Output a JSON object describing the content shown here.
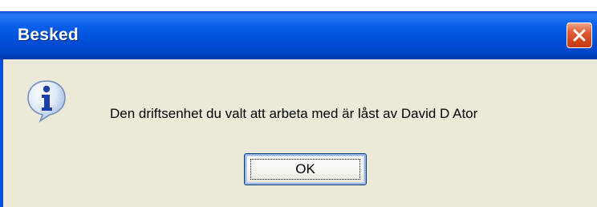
{
  "window": {
    "title": "Besked",
    "close_icon": "close-icon"
  },
  "dialog": {
    "icon": "information-icon",
    "message": "Den driftsenhet du valt att arbeta med är låst av David D Ator",
    "ok_label": "OK"
  },
  "colors": {
    "titlebar": "#0054e3",
    "dialog_bg": "#ece9d8",
    "close_button": "#d4461d"
  }
}
